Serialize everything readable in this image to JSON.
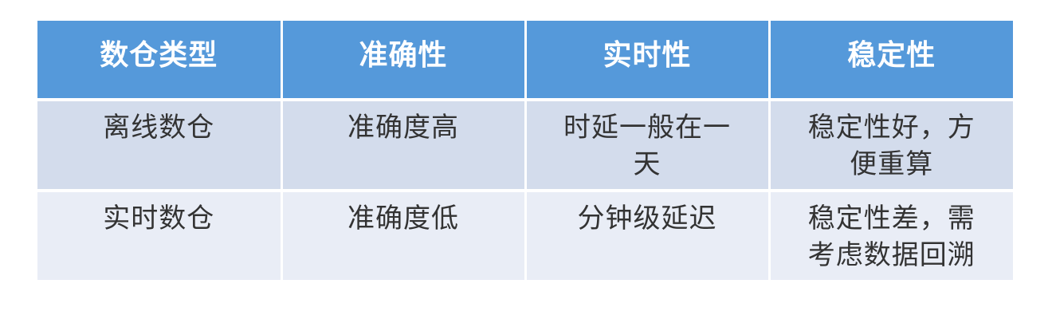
{
  "table": {
    "headers": [
      "数仓类型",
      "准确性",
      "实时性",
      "稳定性"
    ],
    "rows": [
      [
        "离线数仓",
        "准确度高",
        "时延一般在一天",
        "稳定性好，方便重算"
      ],
      [
        "实时数仓",
        "准确度低",
        "分钟级延迟",
        "稳定性差，需考虑数据回溯"
      ]
    ]
  },
  "colors": {
    "header_bg": "#5599da",
    "header_text": "#ffffff",
    "row1_bg": "#d3dcec",
    "row2_bg": "#e9edf6",
    "cell_text": "#333333",
    "grid_line": "#ffffff"
  }
}
